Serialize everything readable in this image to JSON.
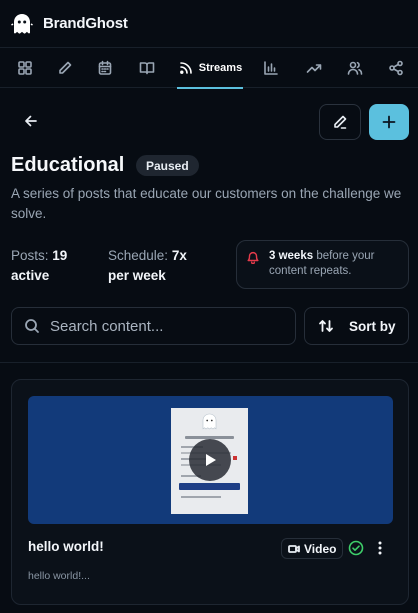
{
  "app": {
    "name": "BrandGhost",
    "logo_icon": "ghost-icon"
  },
  "nav": {
    "items": [
      {
        "id": "dashboard",
        "icon": "grid-icon"
      },
      {
        "id": "compose",
        "icon": "pencil-icon"
      },
      {
        "id": "calendar",
        "icon": "calendar-icon"
      },
      {
        "id": "library",
        "icon": "book-icon"
      },
      {
        "id": "streams",
        "icon": "rss-icon",
        "label": "Streams",
        "active": true
      },
      {
        "id": "analytics",
        "icon": "bar-chart-icon"
      },
      {
        "id": "trends",
        "icon": "trending-up-icon"
      },
      {
        "id": "team",
        "icon": "users-icon"
      },
      {
        "id": "share",
        "icon": "share-icon"
      }
    ]
  },
  "stream": {
    "title": "Educational",
    "status": "Paused",
    "description": "A series of posts that educate our customers on the challenge we solve.",
    "posts_label": "Posts:",
    "posts_value": "19",
    "posts_suffix": "active",
    "schedule_label": "Schedule:",
    "schedule_value": "7x",
    "schedule_suffix": "per week",
    "repeat_strong": "3 weeks",
    "repeat_rest": " before your content repeats."
  },
  "toolbar": {
    "search_placeholder": "Search content...",
    "sort_label": "Sort by"
  },
  "posts": [
    {
      "title": "hello world!",
      "type": "Video",
      "snippet": "hello world!...",
      "status_icon": "check-circle-icon"
    }
  ],
  "colors": {
    "accent": "#5bc0de",
    "background": "#070c13",
    "alert": "#e53b4b",
    "success": "#3ecf6a",
    "thumbnail_bg": "#123a7a"
  }
}
